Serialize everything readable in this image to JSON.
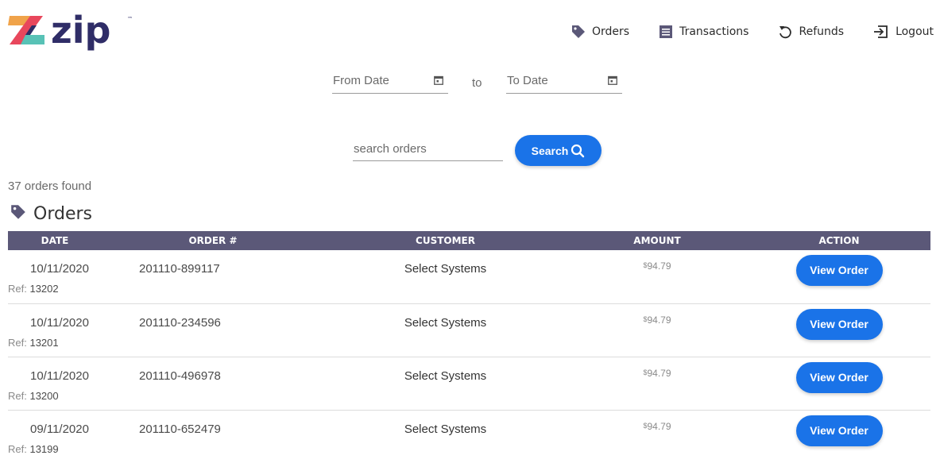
{
  "brand": {
    "name": "zip",
    "tm": "™",
    "logo_colors": [
      "#f0a34a",
      "#e8475c",
      "#2f2d67",
      "#58c2b6"
    ]
  },
  "nav": {
    "items": [
      {
        "label": "Orders",
        "icon": "tag-icon"
      },
      {
        "label": "Transactions",
        "icon": "list-icon"
      },
      {
        "label": "Refunds",
        "icon": "undo-icon"
      },
      {
        "label": "Logout",
        "icon": "logout-icon"
      }
    ]
  },
  "filters": {
    "from_label": "From Date",
    "to_text": "to",
    "to_label": "To Date",
    "search_placeholder": "search orders",
    "search_value": "",
    "search_button": "Search"
  },
  "results": {
    "count_text": "37 orders found",
    "section_title": "Orders",
    "columns": [
      "DATE",
      "ORDER #",
      "CUSTOMER",
      "AMOUNT",
      "ACTION"
    ],
    "ref_prefix": "Ref: ",
    "currency": "$",
    "rows": [
      {
        "date": "10/11/2020",
        "ref": "13202",
        "order": "201110-899117",
        "customer": "Select Systems",
        "amount": "94.79",
        "action": "View Order"
      },
      {
        "date": "10/11/2020",
        "ref": "13201",
        "order": "201110-234596",
        "customer": "Select Systems",
        "amount": "94.79",
        "action": "View Order"
      },
      {
        "date": "10/11/2020",
        "ref": "13200",
        "order": "201110-496978",
        "customer": "Select Systems",
        "amount": "94.79",
        "action": "View Order"
      },
      {
        "date": "09/11/2020",
        "ref": "13199",
        "order": "201110-652479",
        "customer": "Select Systems",
        "amount": "94.79",
        "action": "View Order"
      }
    ]
  },
  "colors": {
    "accent": "#1a73e8",
    "table_header": "#5b5878"
  }
}
